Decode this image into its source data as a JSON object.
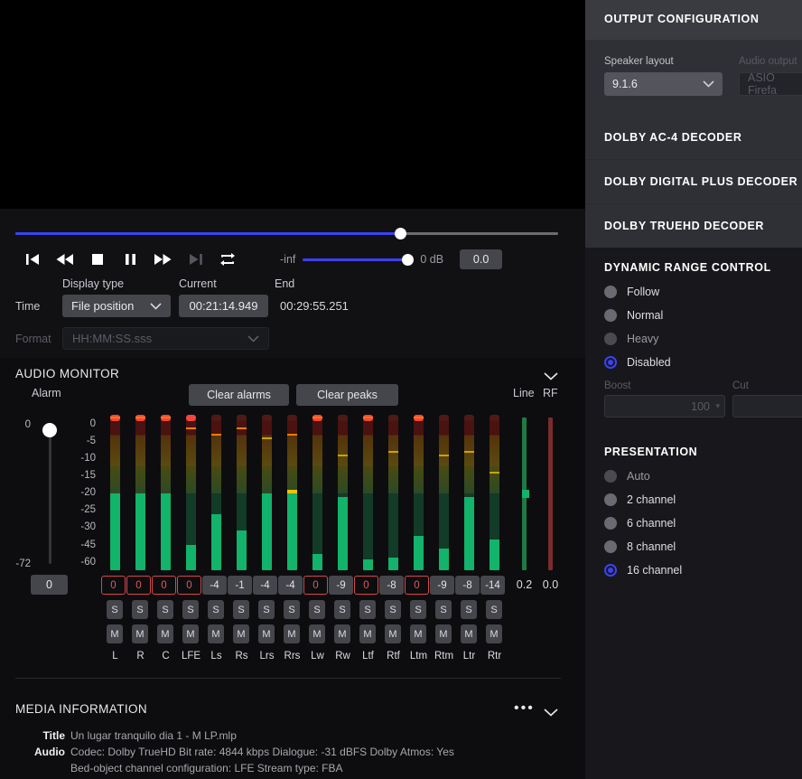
{
  "transport": {
    "buttons": [
      {
        "name": "skip-to-start",
        "icon": "skip-back-icon"
      },
      {
        "name": "rewind",
        "icon": "rewind-icon"
      },
      {
        "name": "stop",
        "icon": "stop-icon"
      },
      {
        "name": "pause",
        "icon": "pause-icon"
      },
      {
        "name": "fast-forward",
        "icon": "fast-forward-icon"
      },
      {
        "name": "skip-to-end",
        "icon": "skip-forward-icon"
      },
      {
        "name": "loop",
        "icon": "loop-icon"
      }
    ],
    "seek_percent": 71,
    "volume_min_label": "-inf",
    "volume_value_label": "0 dB",
    "volume_box_value": "0.0",
    "volume_percent": 90
  },
  "time": {
    "row_label": "Time",
    "display_type_label": "Display type",
    "display_type_value": "File position",
    "current_label": "Current",
    "current_value": "00:21:14.949",
    "end_label": "End",
    "end_value": "00:29:55.251",
    "format_label": "Format",
    "format_value": "HH:MM:SS.sss"
  },
  "audio_monitor": {
    "title": "AUDIO MONITOR",
    "alarm_label": "Alarm",
    "alarm_max": "0",
    "alarm_min": "-72",
    "alarm_value": "0",
    "clear_alarms_label": "Clear alarms",
    "clear_peaks_label": "Clear peaks",
    "line_label": "Line",
    "rf_label": "RF",
    "scale": [
      "0",
      "-5",
      "-10",
      "-15",
      "-20",
      "-25",
      "-30",
      "-45",
      "-60"
    ],
    "solo_label": "S",
    "mute_label": "M",
    "channels": [
      {
        "label": "L",
        "value": "0",
        "clip": true,
        "level_db": -20,
        "peak_db": 0,
        "peak_hold": true
      },
      {
        "label": "R",
        "value": "0",
        "clip": true,
        "level_db": -20,
        "peak_db": 0,
        "peak_hold": true
      },
      {
        "label": "C",
        "value": "0",
        "clip": true,
        "level_db": -20,
        "peak_db": 0,
        "peak_hold": true
      },
      {
        "label": "LFE",
        "value": "0",
        "clip": true,
        "level_db": -44,
        "peak_db": -1,
        "peak_hold": true
      },
      {
        "label": "Ls",
        "value": "-4",
        "clip": false,
        "level_db": -26,
        "peak_db": -3,
        "peak_hold": false
      },
      {
        "label": "Rs",
        "value": "-1",
        "clip": false,
        "level_db": -32,
        "peak_db": -1,
        "peak_hold": false
      },
      {
        "label": "Lrs",
        "value": "-4",
        "clip": false,
        "level_db": -20,
        "peak_db": -4,
        "peak_hold": false
      },
      {
        "label": "Rrs",
        "value": "-4",
        "clip": false,
        "level_db": -19,
        "peak_db": -3,
        "peak_hold": false
      },
      {
        "label": "Lw",
        "value": "0",
        "clip": true,
        "level_db": -52,
        "peak_db": 0,
        "peak_hold": true
      },
      {
        "label": "Rw",
        "value": "-9",
        "clip": false,
        "level_db": -21,
        "peak_db": -9,
        "peak_hold": false
      },
      {
        "label": "Ltf",
        "value": "0",
        "clip": true,
        "level_db": -57,
        "peak_db": 0,
        "peak_hold": true
      },
      {
        "label": "Rtf",
        "value": "-8",
        "clip": false,
        "level_db": -55,
        "peak_db": -8,
        "peak_hold": false
      },
      {
        "label": "Ltm",
        "value": "0",
        "clip": true,
        "level_db": -37,
        "peak_db": 0,
        "peak_hold": true
      },
      {
        "label": "Rtm",
        "value": "-9",
        "clip": false,
        "level_db": -47,
        "peak_db": -9,
        "peak_hold": false
      },
      {
        "label": "Ltr",
        "value": "-8",
        "clip": false,
        "level_db": -21,
        "peak_db": -8,
        "peak_hold": false
      },
      {
        "label": "Rtr",
        "value": "-14",
        "clip": false,
        "level_db": -40,
        "peak_db": -14,
        "peak_hold": false
      }
    ],
    "loudness": [
      {
        "name": "loudness-meter-green",
        "value": "0.2",
        "marker_db": -20,
        "color": "#1f7a45"
      },
      {
        "name": "loudness-meter-red",
        "value": "0.0",
        "marker_db": null,
        "color": "#7a2b2e"
      }
    ]
  },
  "media_information": {
    "title": "MEDIA INFORMATION",
    "rows": [
      {
        "key": "Title",
        "value": "Un lugar tranquilo dia 1 - M LP.mlp"
      },
      {
        "key": "Audio",
        "value": "Codec: Dolby TrueHD     Bit rate: 4844 kbps     Dialogue: -31 dBFS     Dolby Atmos: Yes"
      },
      {
        "key": "",
        "value": "Bed-object channel configuration: LFE     Stream type: FBA"
      }
    ]
  },
  "right_panel": {
    "header": "OUTPUT CONFIGURATION",
    "speaker_layout_label": "Speaker layout",
    "speaker_layout_value": "9.1.6",
    "audio_output_label": "Audio output ",
    "audio_output_value": "ASIO Firefa",
    "decoders": [
      {
        "name": "dolby-ac4-decoder",
        "label": "DOLBY AC-4 DECODER"
      },
      {
        "name": "dolby-digital-plus-decoder",
        "label": "DOLBY DIGITAL PLUS DECODER"
      },
      {
        "name": "dolby-truehd-decoder",
        "label": "DOLBY TRUEHD DECODER"
      }
    ],
    "drc": {
      "title": "DYNAMIC RANGE CONTROL",
      "options": [
        {
          "label": "Follow",
          "selected": false,
          "dim": false
        },
        {
          "label": "Normal",
          "selected": false,
          "dim": false
        },
        {
          "label": "Heavy",
          "selected": false,
          "dim": true
        },
        {
          "label": "Disabled",
          "selected": true,
          "dim": false
        }
      ],
      "boost_label": "Boost",
      "boost_value": "100",
      "cut_label": "Cut",
      "cut_value": ""
    },
    "presentation": {
      "title": "PRESENTATION",
      "options": [
        {
          "label": "Auto",
          "selected": false,
          "dim": true
        },
        {
          "label": "2 channel",
          "selected": false,
          "dim": false
        },
        {
          "label": "6 channel",
          "selected": false,
          "dim": false
        },
        {
          "label": "8 channel",
          "selected": false,
          "dim": false
        },
        {
          "label": "16 channel",
          "selected": true,
          "dim": false
        }
      ]
    }
  },
  "colors": {
    "accent": "#3b43f0",
    "clip_red": "#d4484a",
    "meter_green": "#12b36a",
    "meter_yellow": "#f2c200",
    "meter_orange": "#f57c00",
    "meter_peak": "#f4413f"
  }
}
